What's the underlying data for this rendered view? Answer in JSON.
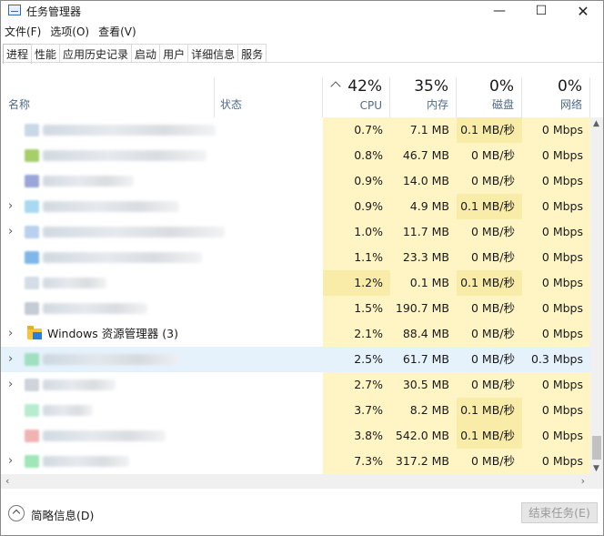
{
  "window": {
    "title": "任务管理器",
    "controls": {
      "minimize": "—",
      "maximize": "☐",
      "close": "✕"
    }
  },
  "menu": [
    "文件(F)",
    "选项(O)",
    "查看(V)"
  ],
  "tabs": [
    "进程",
    "性能",
    "应用历史记录",
    "启动",
    "用户",
    "详细信息",
    "服务"
  ],
  "active_tab": "进程",
  "columns": {
    "name": "名称",
    "status": "状态",
    "cpu": {
      "pct": "42%",
      "label": "CPU"
    },
    "memory": {
      "pct": "35%",
      "label": "内存"
    },
    "disk": {
      "pct": "0%",
      "label": "磁盘"
    },
    "network": {
      "pct": "0%",
      "label": "网络"
    }
  },
  "rows": [
    {
      "name": "",
      "expandable": false,
      "cpu": "0.7%",
      "memory": "7.1 MB",
      "disk": "0.1 MB/秒",
      "network": "0 Mbps"
    },
    {
      "name": "",
      "expandable": false,
      "cpu": "0.8%",
      "memory": "46.7 MB",
      "disk": "0 MB/秒",
      "network": "0 Mbps"
    },
    {
      "name": "",
      "expandable": false,
      "cpu": "0.9%",
      "memory": "14.0 MB",
      "disk": "0 MB/秒",
      "network": "0 Mbps"
    },
    {
      "name": "",
      "expandable": true,
      "cpu": "0.9%",
      "memory": "4.9 MB",
      "disk": "0.1 MB/秒",
      "network": "0 Mbps"
    },
    {
      "name": "",
      "expandable": true,
      "cpu": "1.0%",
      "memory": "11.7 MB",
      "disk": "0 MB/秒",
      "network": "0 Mbps"
    },
    {
      "name": "",
      "expandable": false,
      "cpu": "1.1%",
      "memory": "23.3 MB",
      "disk": "0 MB/秒",
      "network": "0 Mbps"
    },
    {
      "name": "",
      "expandable": false,
      "cpu": "1.2%",
      "memory": "0.1 MB",
      "disk": "0.1 MB/秒",
      "network": "0 Mbps"
    },
    {
      "name": "",
      "expandable": false,
      "cpu": "1.5%",
      "memory": "190.7 MB",
      "disk": "0 MB/秒",
      "network": "0 Mbps"
    },
    {
      "name": "Windows 资源管理器 (3)",
      "expandable": true,
      "cpu": "2.1%",
      "memory": "88.4 MB",
      "disk": "0 MB/秒",
      "network": "0 Mbps"
    },
    {
      "name": "",
      "expandable": true,
      "selected": true,
      "cpu": "2.5%",
      "memory": "61.7 MB",
      "disk": "0 MB/秒",
      "network": "0.3 Mbps"
    },
    {
      "name": "",
      "expandable": true,
      "cpu": "2.7%",
      "memory": "30.5 MB",
      "disk": "0 MB/秒",
      "network": "0 Mbps"
    },
    {
      "name": "",
      "expandable": false,
      "cpu": "3.7%",
      "memory": "8.2 MB",
      "disk": "0.1 MB/秒",
      "network": "0 Mbps"
    },
    {
      "name": "",
      "expandable": false,
      "cpu": "3.8%",
      "memory": "542.0 MB",
      "disk": "0.1 MB/秒",
      "network": "0 Mbps"
    },
    {
      "name": "",
      "expandable": true,
      "cpu": "7.3%",
      "memory": "317.2 MB",
      "disk": "0 MB/秒",
      "network": "0 Mbps"
    }
  ],
  "footer": {
    "fewer_details": "简略信息(D)",
    "end_task": "结束任务(E)"
  },
  "colors": {
    "heat_light": "#fff4c4",
    "heat_dark": "#f9eca8",
    "selected_row": "#e5f1fb",
    "header_label": "#4d6a8a"
  }
}
